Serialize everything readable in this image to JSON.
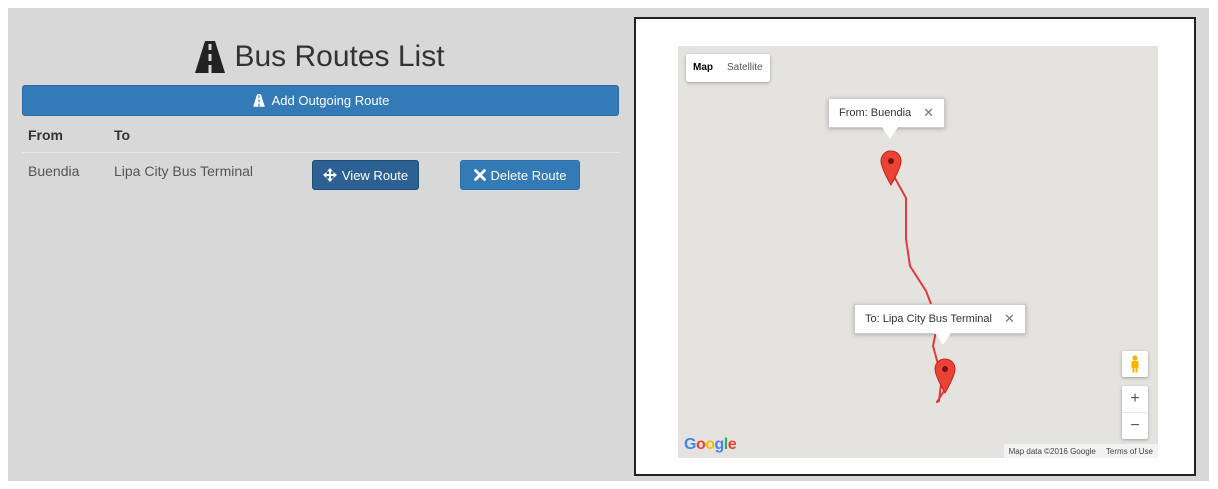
{
  "header": {
    "title": "Bus Routes List",
    "title_icon": "road-icon"
  },
  "actions": {
    "add_outgoing_label": "Add Outgoing Route"
  },
  "table": {
    "columns": [
      "From",
      "To"
    ],
    "rows": [
      {
        "from": "Buendia",
        "to": "Lipa City Bus Terminal",
        "view_label": "View Route",
        "delete_label": "Delete Route"
      }
    ]
  },
  "map": {
    "map_types": [
      "Map",
      "Satellite"
    ],
    "active_map_type": "Map",
    "origin_info": "From: Buendia",
    "destination_info": "To: Lipa City Bus Terminal",
    "logo": "Google",
    "attribution": "Map data ©2016 Google",
    "terms": "Terms of Use",
    "zoom_in": "+",
    "zoom_out": "−",
    "close_glyph": "✕"
  },
  "colors": {
    "primary": "#337ab7",
    "active": "#2e6193",
    "route": "#e3393a",
    "panel": "#d8d8d8"
  }
}
